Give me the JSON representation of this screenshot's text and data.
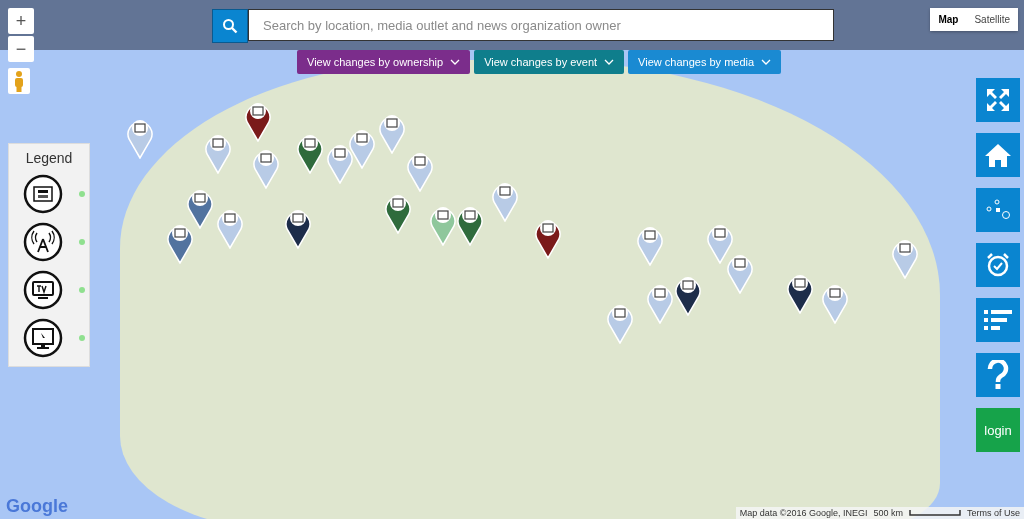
{
  "map_controls": {
    "zoom_in": "+",
    "zoom_out": "−"
  },
  "search": {
    "placeholder": "Search by location, media outlet and news organization owner"
  },
  "map_type": [
    {
      "label": "Map",
      "selected": true
    },
    {
      "label": "Satellite",
      "selected": false
    }
  ],
  "filters": [
    {
      "label": "View changes by ownership",
      "color": "#7b2d8b"
    },
    {
      "label": "View changes by event",
      "color": "#0f7e8c"
    },
    {
      "label": "View changes by media",
      "color": "#1a8ad2"
    }
  ],
  "legend": {
    "title": "Legend",
    "items": [
      {
        "kind": "newspaper"
      },
      {
        "kind": "radio"
      },
      {
        "kind": "tv"
      },
      {
        "kind": "online"
      }
    ]
  },
  "side_buttons": [
    {
      "kind": "fullscreen"
    },
    {
      "kind": "home"
    },
    {
      "kind": "route"
    },
    {
      "kind": "alarm"
    },
    {
      "kind": "list"
    },
    {
      "kind": "help"
    },
    {
      "kind": "login",
      "label": "login"
    }
  ],
  "markers": [
    {
      "color": "#b8cbe6"
    },
    {
      "color": "#7a1a1a"
    },
    {
      "color": "#b8cbe6"
    },
    {
      "color": "#52739f"
    },
    {
      "color": "#b8cbe6"
    },
    {
      "color": "#2f6b3c"
    },
    {
      "color": "#b8cbe6"
    },
    {
      "color": "#b8cbe6"
    },
    {
      "color": "#b8cbe6"
    },
    {
      "color": "#b8cbe6"
    },
    {
      "color": "#2f6b3c"
    },
    {
      "color": "#8fc79c"
    },
    {
      "color": "#2f6b3c"
    },
    {
      "color": "#b8cbe6"
    },
    {
      "color": "#7a1a1a"
    },
    {
      "color": "#52739f"
    },
    {
      "color": "#1d2d4a"
    },
    {
      "color": "#b8cbe6"
    },
    {
      "color": "#b8cbe6"
    },
    {
      "color": "#1d2d4a"
    },
    {
      "color": "#b8cbe6"
    },
    {
      "color": "#b8cbe6"
    },
    {
      "color": "#b8cbe6"
    },
    {
      "color": "#b8cbe6"
    },
    {
      "color": "#1d2d4a"
    },
    {
      "color": "#b8cbe6"
    },
    {
      "color": "#b8cbe6"
    }
  ],
  "attribution": {
    "logo": "Google",
    "map_data": "Map data ©2016 Google, INEGI",
    "scale": "500 km",
    "terms": "Terms of Use"
  }
}
